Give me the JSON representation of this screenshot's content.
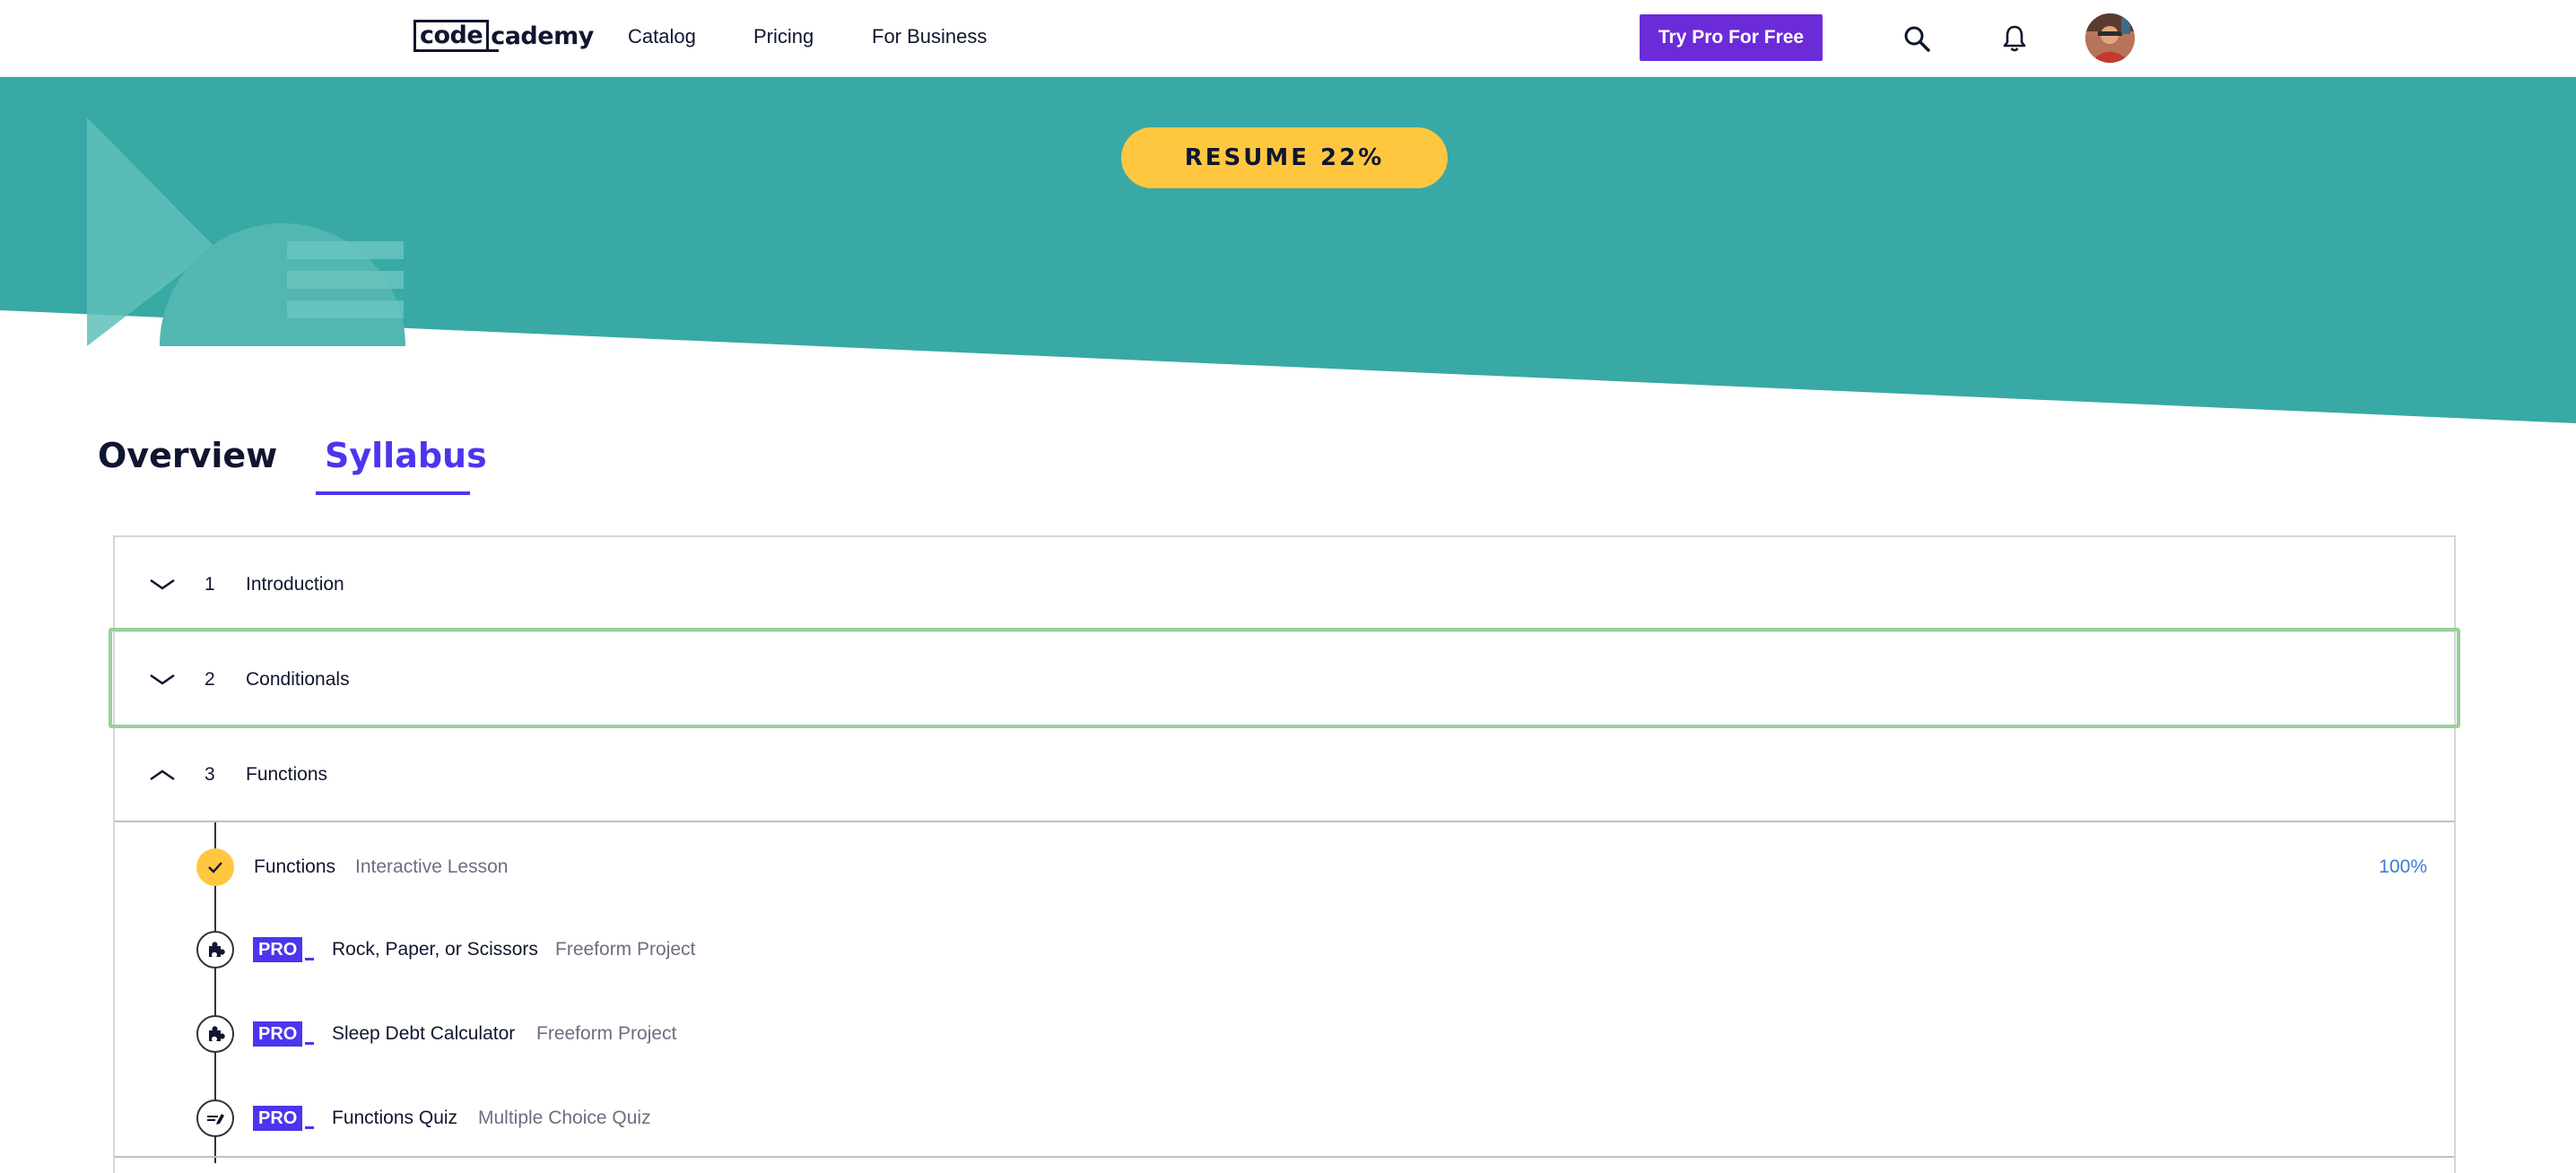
{
  "nav": {
    "logo_box": "code",
    "logo_rest": "cademy",
    "links": [
      "Catalog",
      "Pricing",
      "For Business"
    ],
    "pro_button": "Try Pro For Free"
  },
  "hero": {
    "resume_label": "RESUME 22%",
    "progress_percent": 22,
    "color": "#38a9a5"
  },
  "tabs": {
    "overview": "Overview",
    "syllabus": "Syllabus"
  },
  "modules": [
    {
      "number": "1",
      "title": "Introduction",
      "expanded": false
    },
    {
      "number": "2",
      "title": "Conditionals",
      "expanded": false
    },
    {
      "number": "3",
      "title": "Functions",
      "expanded": true
    }
  ],
  "lessons": [
    {
      "title": "Functions",
      "type": "Interactive Lesson",
      "pro": false,
      "status": "complete",
      "progress": "100%",
      "icon": "check-icon"
    },
    {
      "title": "Rock, Paper, or Scissors",
      "type": "Freeform Project",
      "pro": true,
      "badge": "PRO",
      "icon": "puzzle-icon"
    },
    {
      "title": "Sleep Debt Calculator",
      "type": "Freeform Project",
      "pro": true,
      "badge": "PRO",
      "icon": "puzzle-icon"
    },
    {
      "title": "Functions Quiz",
      "type": "Multiple Choice Quiz",
      "pro": true,
      "badge": "PRO",
      "icon": "quiz-icon"
    }
  ],
  "colors": {
    "accent": "#4b35ef",
    "pro_button": "#6c2bd9",
    "resume": "#ffc740",
    "progress_text": "#3a7bd5"
  }
}
